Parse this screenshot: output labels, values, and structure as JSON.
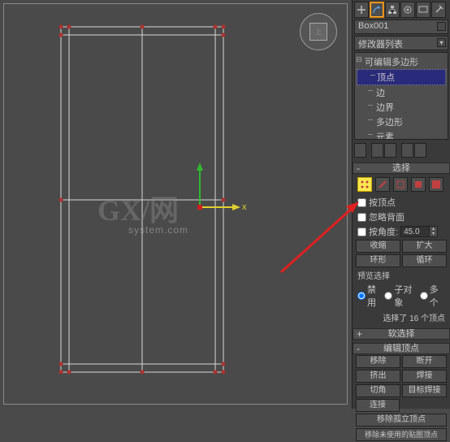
{
  "viewport": {
    "viewcube_label": "上"
  },
  "panel": {
    "object_name": "Box001",
    "modifier_dropdown": "修改器列表",
    "tree": {
      "root": "可编辑多边形",
      "items": [
        "顶点",
        "边",
        "边界",
        "多边形",
        "元素"
      ],
      "selected_index": 0
    },
    "rollouts": {
      "selection": {
        "title": "选择",
        "by_vertex": "按顶点",
        "ignore_backface": "忽略背面",
        "by_angle": "按角度:",
        "angle_value": "45.0",
        "shrink": "收缩",
        "expand": "扩大",
        "ring": "环形",
        "loop": "循环",
        "preview_label": "预览选择",
        "preview_off": "禁用",
        "preview_subobj": "子对象",
        "preview_multi": "多个",
        "status": "选择了 16 个顶点"
      },
      "soft_selection": {
        "title": "软选择"
      },
      "edit_vertices": {
        "title": "编辑顶点",
        "remove": "移除",
        "break": "断开",
        "extrude": "挤出",
        "weld": "焊接",
        "chamfer": "切角",
        "target_weld": "目标焊接",
        "connect": "连接",
        "remove_iso": "移除孤立顶点",
        "remove_unused": "移除未使用的贴图顶点"
      }
    }
  }
}
